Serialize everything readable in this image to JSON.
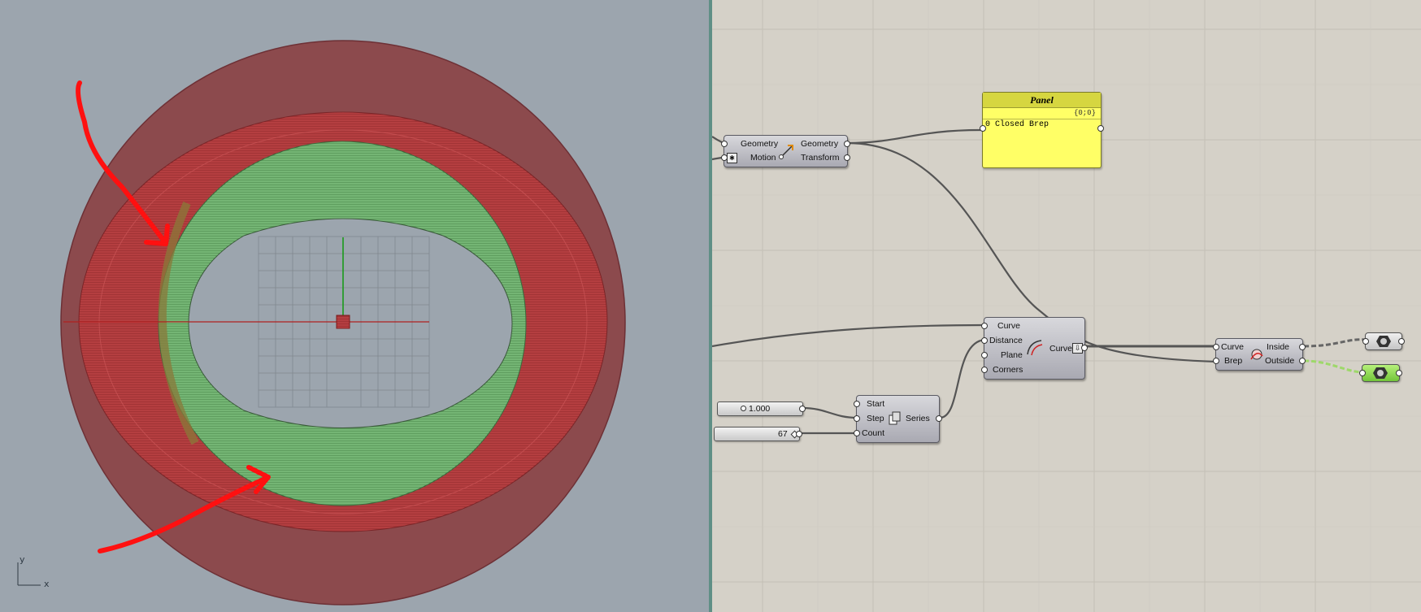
{
  "viewport": {
    "axis_y_label": "y",
    "axis_x_label": "x",
    "colors": {
      "background": "#9ca5ae",
      "outer_ring": "#8c4a4d",
      "red_hatch": "#b03a3c",
      "green_band": "#6aa86a",
      "annotation_arrow": "#ff1010"
    }
  },
  "canvas": {
    "move_component": {
      "inputs": [
        "Geometry",
        "Motion"
      ],
      "outputs": [
        "Geometry",
        "Transform"
      ],
      "icon": "move-arrow-icon"
    },
    "panel": {
      "title": "Panel",
      "path": "{0;0}",
      "index": "0",
      "content": "Closed Brep"
    },
    "offset_component": {
      "inputs": [
        "Curve",
        "Distance",
        "Plane",
        "Corners"
      ],
      "output": "Curve",
      "icon": "offset-curve-icon"
    },
    "series_component": {
      "inputs": [
        "Start",
        "Step",
        "Count"
      ],
      "output": "Series",
      "icon": "series-icon"
    },
    "slider_step": {
      "value": "1.000"
    },
    "slider_count": {
      "value": "67"
    },
    "containment_component": {
      "inputs": [
        "Curve",
        "Brep"
      ],
      "outputs": [
        "Inside",
        "Outside"
      ],
      "icon": "trim-containment-icon"
    },
    "preview_params": [
      "curve-param-icon",
      "curve-param-icon"
    ],
    "colors": {
      "background": "#d5d1c8",
      "panel": "#ffff66",
      "selected_param": "#8ed84a",
      "wire": "#555555"
    }
  }
}
